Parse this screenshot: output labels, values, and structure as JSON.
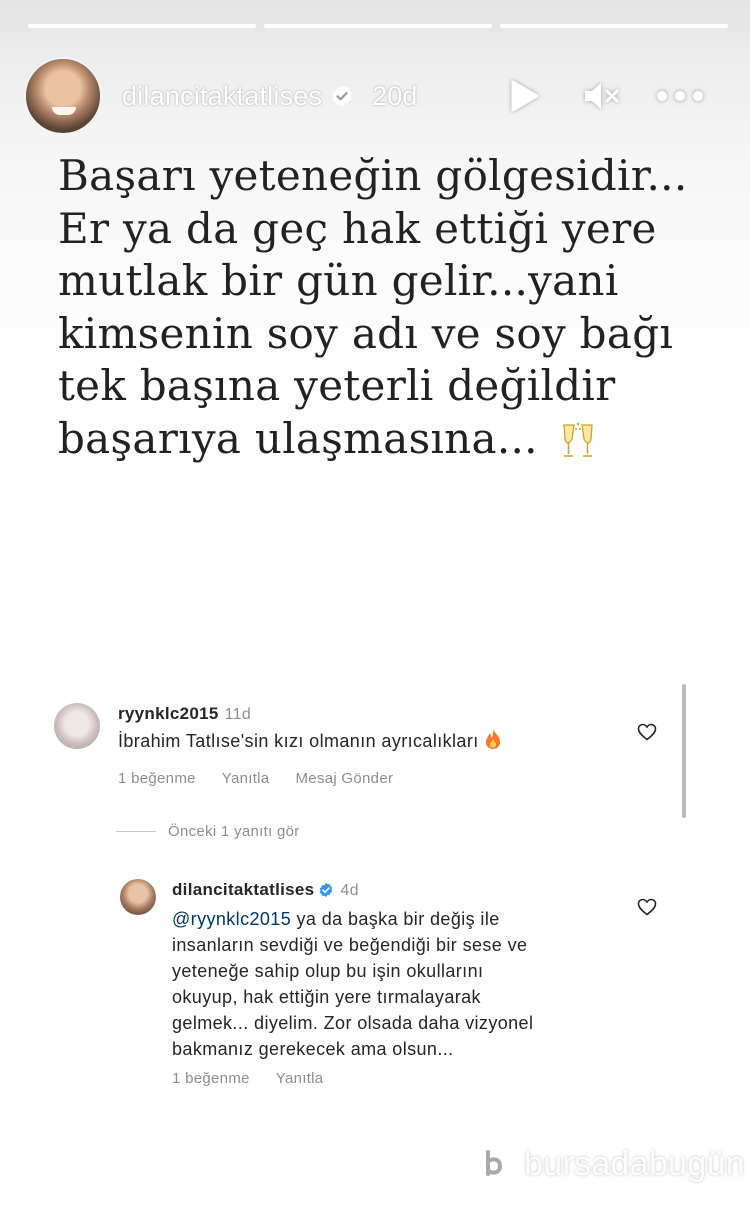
{
  "story": {
    "progress": [
      1,
      1,
      1
    ],
    "active_segment": 3,
    "username": "dilancitaktatlises",
    "verified": true,
    "time": "20d",
    "icons": [
      "play-icon",
      "mute-icon",
      "more-icon"
    ],
    "quote_lines": [
      "Başarı yeteneğin gölgesidir...",
      "Er ya da geç hak ettiği yere",
      "mutlak bir gün gelir...yani",
      "kimsenin soy adı ve soy bağı",
      "tek başına yeterli değildir",
      "başarıya ulaşmasına..."
    ],
    "quote_emoji": "clinking-glasses-icon"
  },
  "comments": {
    "first": {
      "username": "ryynklc2015",
      "time": "11d",
      "text": "İbrahim Tatlıse'sin kızı olmanın ayrıcalıkları",
      "emoji": "fire-icon",
      "likes": "1 beğenme",
      "reply": "Yanıtla",
      "send_message": "Mesaj Gönder"
    },
    "view_replies": "Önceki 1 yanıtı gör",
    "reply": {
      "username": "dilancitaktatlises",
      "verified": true,
      "time": "4d",
      "mention": "@ryynklc2015",
      "lines": [
        " ya da başka bir değiş ile",
        "insanların sevdiği ve beğendiği bir sese ve",
        "yeteneğe sahip olup bu işin okullarını",
        "okuyup, hak ettiğin yere tırmalayarak",
        "gelmek... diyelim. Zor olsada daha vizyonel",
        "bakmanız gerekecek ama olsun..."
      ],
      "likes": "1 beğenme",
      "reply_label": "Yanıtla"
    }
  },
  "watermark": {
    "text": "bursadabugün"
  },
  "colors": {
    "mention": "#00376b",
    "meta": "#8e8e8e",
    "verified": "#3897f0"
  }
}
